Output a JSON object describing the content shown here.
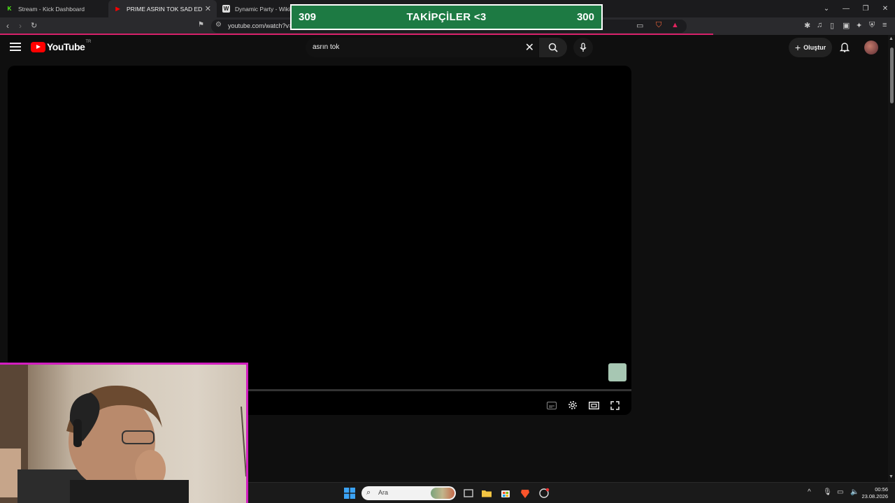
{
  "browser": {
    "tabs": [
      {
        "title": "Stream - Kick Dashboard",
        "favicon": "K",
        "favicon_color": "#53fc18"
      },
      {
        "title": "PRIME ASRIN TOK SAD EDIT - Yo",
        "favicon": "▶",
        "favicon_color": "#ff0000"
      },
      {
        "title": "Dynamic Party - Wikipedi",
        "favicon": "W",
        "favicon_color": "#ffffff"
      }
    ],
    "url": "youtube.com/watch?v="
  },
  "youtube": {
    "logo_text": "YouTube",
    "country_code": "TR",
    "search_value": "asrın tok",
    "create_label": "Oluştur"
  },
  "overlay": {
    "left_count": "309",
    "title": "TAKİPÇİLER <3",
    "right_count": "300"
  },
  "taskbar": {
    "search_label": "Ara",
    "time": "00:56",
    "date": "23.08.2026"
  },
  "colors": {
    "accent_pink": "#d21ebf",
    "banner_green": "#1d7a43",
    "youtube_red": "#ff0000"
  }
}
